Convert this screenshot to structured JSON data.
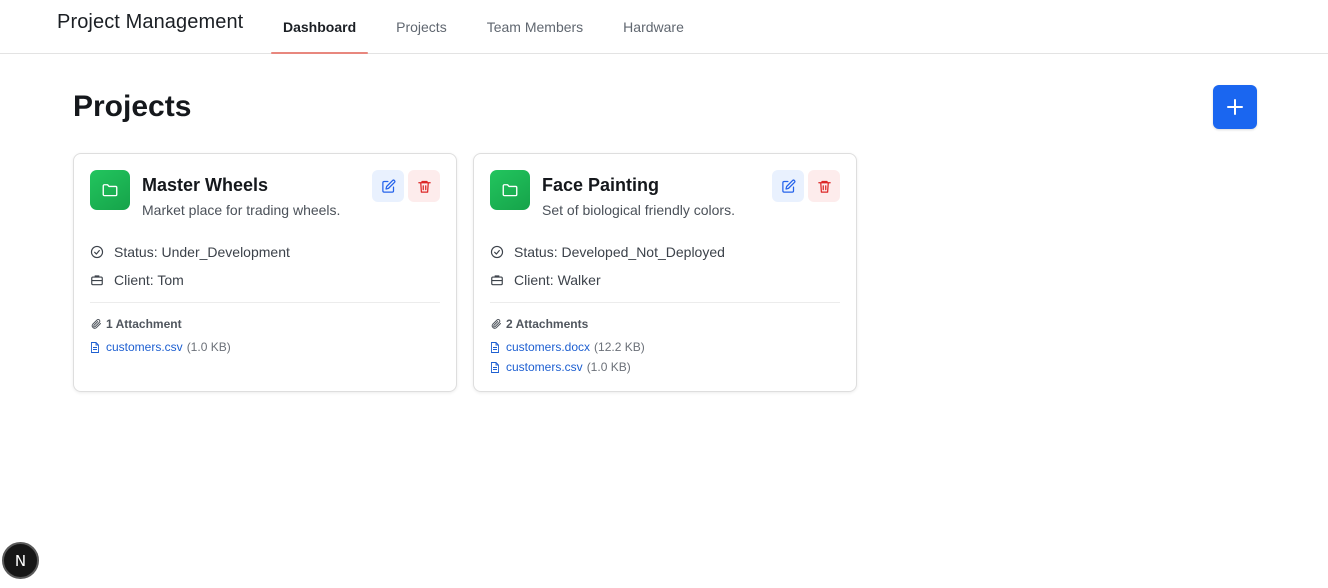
{
  "nav": {
    "brand": "Project Management",
    "tabs": [
      {
        "label": "Dashboard",
        "active": true
      },
      {
        "label": "Projects",
        "active": false
      },
      {
        "label": "Team Members",
        "active": false
      },
      {
        "label": "Hardware",
        "active": false
      }
    ]
  },
  "page": {
    "title": "Projects",
    "add_icon": "plus-icon"
  },
  "projects": [
    {
      "title": "Master Wheels",
      "description": "Market place for trading wheels.",
      "status": "Status: Under_Development",
      "client": "Client: Tom",
      "attachments_label": "1 Attachment",
      "attachments": [
        {
          "name": "customers.csv",
          "size": "(1.0 KB)"
        }
      ]
    },
    {
      "title": "Face Painting",
      "description": "Set of biological friendly colors.",
      "status": "Status: Developed_Not_Deployed",
      "client": "Client: Walker",
      "attachments_label": "2 Attachments",
      "attachments": [
        {
          "name": "customers.docx",
          "size": "(12.2 KB)"
        },
        {
          "name": "customers.csv",
          "size": "(1.0 KB)"
        }
      ]
    }
  ],
  "dev_badge": "N",
  "colors": {
    "accent": "#1a66f0",
    "active_tab_underline": "#e8877e",
    "folder_badge": "#22c55e",
    "edit_icon": "#2563eb",
    "delete_icon": "#dc2626",
    "link": "#1d5fd1"
  }
}
